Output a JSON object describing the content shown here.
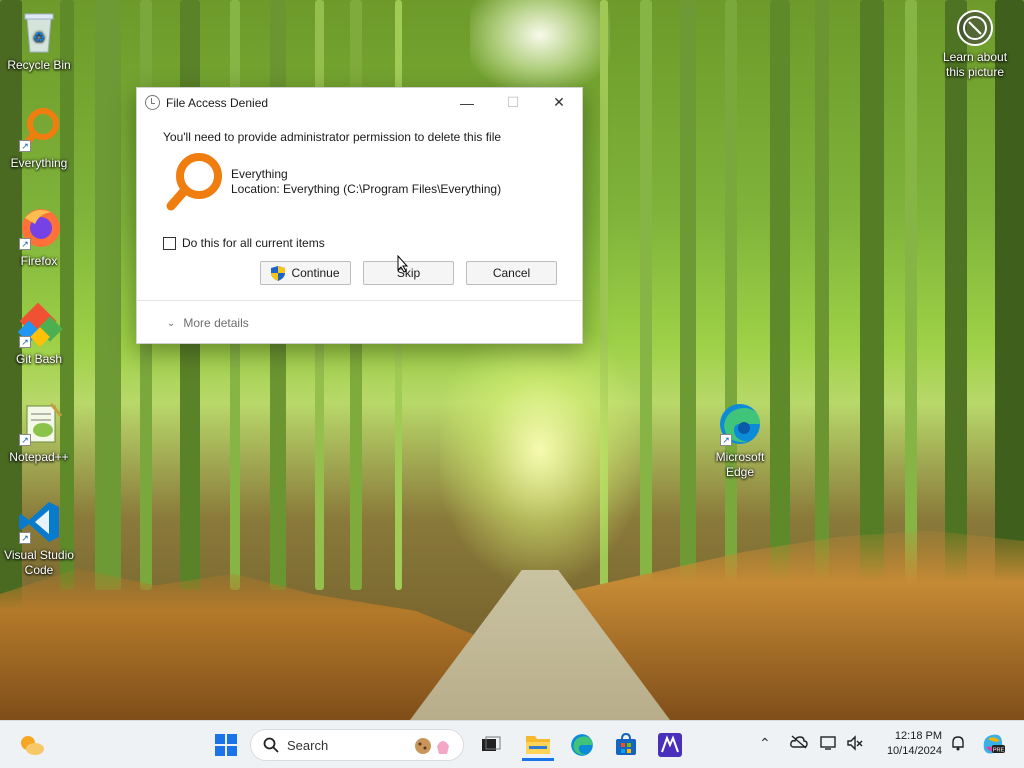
{
  "desktop": {
    "icons": [
      {
        "label": "Recycle Bin"
      },
      {
        "label": "Everything"
      },
      {
        "label": "Firefox"
      },
      {
        "label": "Git Bash"
      },
      {
        "label": "Notepad++"
      },
      {
        "label": "Visual Studio Code"
      },
      {
        "label": "Microsoft Edge"
      }
    ],
    "learn_picture": "Learn about this picture"
  },
  "dialog": {
    "title": "File Access Denied",
    "message": "You'll need to provide administrator permission to delete this file",
    "file_name": "Everything",
    "file_location": "Location: Everything (C:\\Program Files\\Everything)",
    "checkbox_label": "Do this for all current items",
    "checkbox_checked": false,
    "continue_label": "Continue",
    "skip_label": "Skip",
    "cancel_label": "Cancel",
    "more_details_label": "More details",
    "minimize_glyph": "—",
    "maximize_glyph": "☐",
    "close_glyph": "✕"
  },
  "taskbar": {
    "search_placeholder": "Search",
    "time": "12:18 PM",
    "date": "10/14/2024",
    "pinned": [
      "file-explorer-icon",
      "edge-icon",
      "store-icon",
      "mathpix-icon"
    ]
  }
}
